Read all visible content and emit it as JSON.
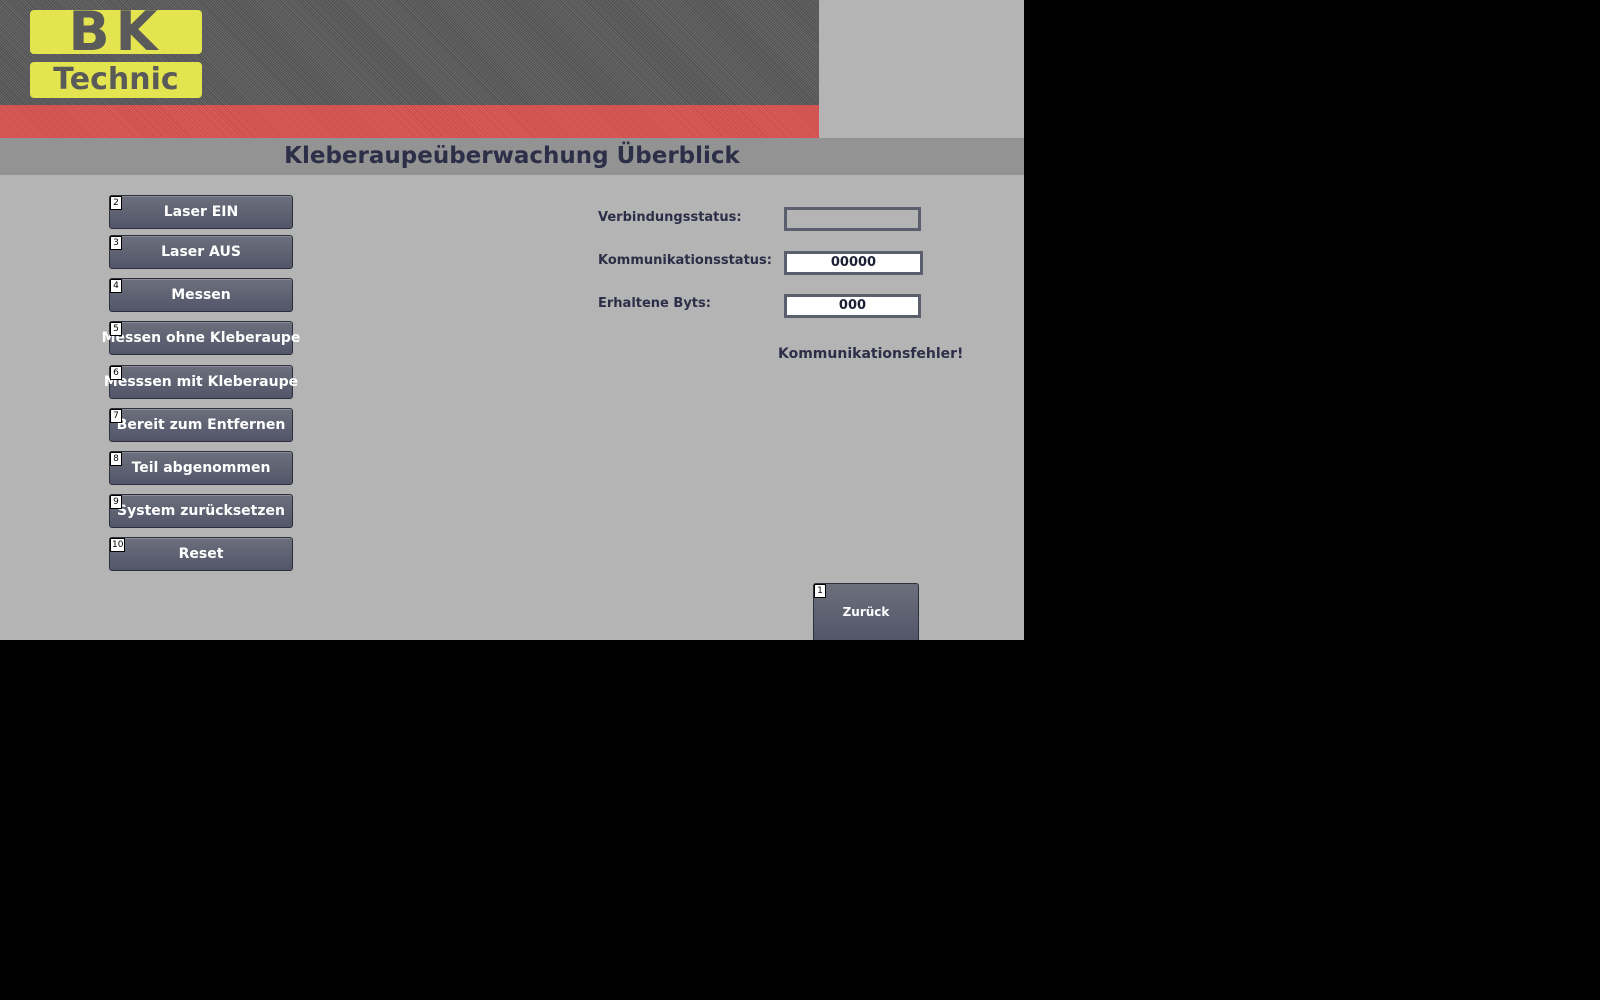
{
  "logo": {
    "top_text": "BK",
    "bottom_text": "Technic"
  },
  "title": "Kleberaupeüberwachung Überblick",
  "buttons": [
    {
      "number": "2",
      "label": "Laser EIN"
    },
    {
      "number": "3",
      "label": "Laser AUS"
    },
    {
      "number": "4",
      "label": "Messen"
    },
    {
      "number": "5",
      "label": "Messen ohne Kleberaupe"
    },
    {
      "number": "6",
      "label": "Messsen mit Kleberaupe"
    },
    {
      "number": "7",
      "label": "Bereit zum Entfernen"
    },
    {
      "number": "8",
      "label": "Teil abgenommen"
    },
    {
      "number": "9",
      "label": "System zurücksetzen"
    },
    {
      "number": "10",
      "label": "Reset"
    }
  ],
  "status": {
    "connection_label": "Verbindungsstatus:",
    "connection_value": "",
    "communication_label": "Kommunikationsstatus:",
    "communication_value": "00000",
    "bytes_label": "Erhaltene Byts:",
    "bytes_value": "000",
    "error_message": "Kommunikationsfehler!"
  },
  "back_button": {
    "number": "1",
    "label": "Zurück"
  },
  "colors": {
    "screen_background": "#b4b4b4",
    "title_bar": "#939393",
    "header_stripe_red": "#e06060",
    "logo_yellow": "#e3e44f",
    "button": "#5f6272",
    "text_dark": "#2c2f47"
  }
}
